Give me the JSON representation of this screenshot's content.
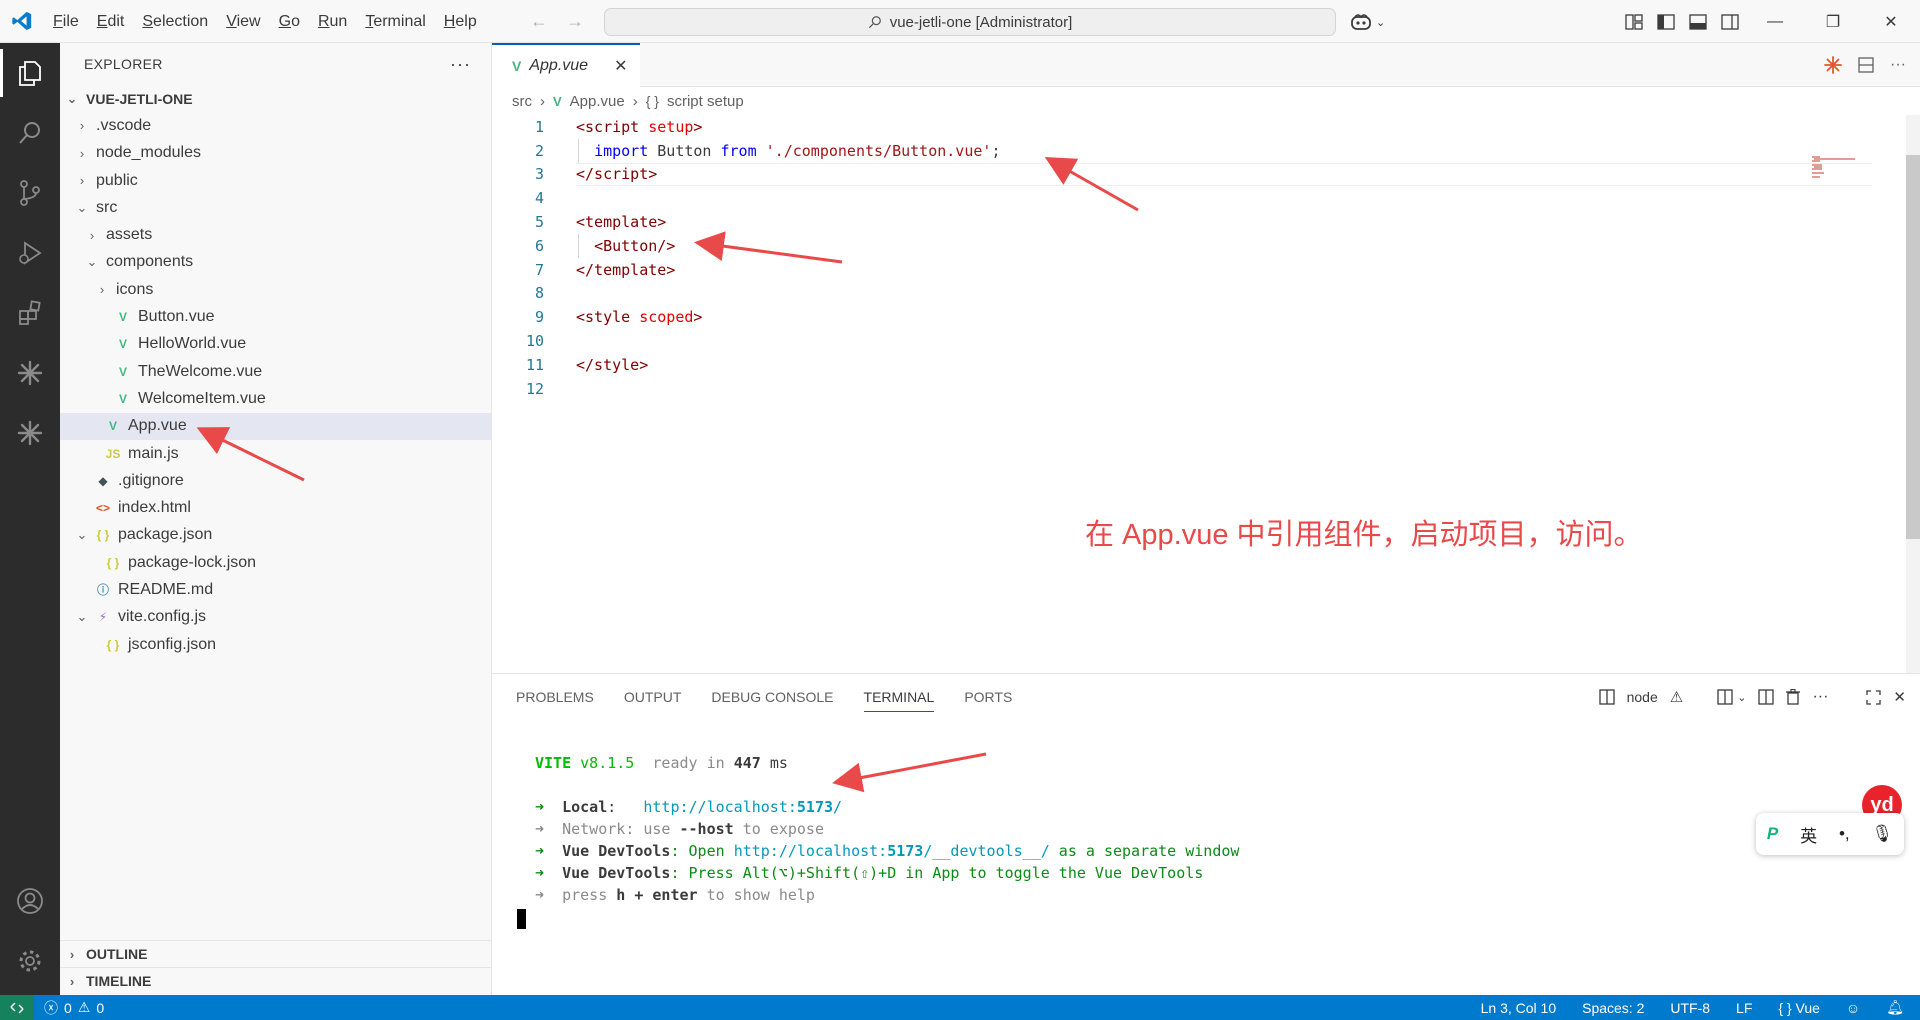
{
  "titlebar": {
    "menus": [
      {
        "label": "File",
        "u": "F",
        "rest": "ile"
      },
      {
        "label": "Edit",
        "u": "E",
        "rest": "dit"
      },
      {
        "label": "Selection",
        "u": "S",
        "rest": "election"
      },
      {
        "label": "View",
        "u": "V",
        "rest": "iew"
      },
      {
        "label": "Go",
        "u": "G",
        "rest": "o"
      },
      {
        "label": "Run",
        "u": "R",
        "rest": "un"
      },
      {
        "label": "Terminal",
        "u": "T",
        "rest": "erminal"
      },
      {
        "label": "Help",
        "u": "H",
        "rest": "elp"
      }
    ],
    "search_text": "vue-jetli-one [Administrator]"
  },
  "sidebar": {
    "title": "EXPLORER",
    "project": "VUE-JETLI-ONE",
    "tree": [
      {
        "name": ".vscode",
        "kind": "folder",
        "open": false,
        "depth": 1
      },
      {
        "name": "node_modules",
        "kind": "folder",
        "open": false,
        "depth": 1
      },
      {
        "name": "public",
        "kind": "folder",
        "open": false,
        "depth": 1
      },
      {
        "name": "src",
        "kind": "folder",
        "open": true,
        "depth": 1
      },
      {
        "name": "assets",
        "kind": "folder",
        "open": false,
        "depth": 2
      },
      {
        "name": "components",
        "kind": "folder",
        "open": true,
        "depth": 2
      },
      {
        "name": "icons",
        "kind": "folder",
        "open": false,
        "depth": 3
      },
      {
        "name": "Button.vue",
        "kind": "vue",
        "depth": 3
      },
      {
        "name": "HelloWorld.vue",
        "kind": "vue",
        "depth": 3
      },
      {
        "name": "TheWelcome.vue",
        "kind": "vue",
        "depth": 3
      },
      {
        "name": "WelcomeItem.vue",
        "kind": "vue",
        "depth": 3
      },
      {
        "name": "App.vue",
        "kind": "vue",
        "depth": 2,
        "selected": true
      },
      {
        "name": "main.js",
        "kind": "js",
        "depth": 2
      },
      {
        "name": ".gitignore",
        "kind": "git",
        "depth": 1
      },
      {
        "name": "index.html",
        "kind": "html",
        "depth": 1
      },
      {
        "name": "package.json",
        "kind": "json",
        "open": true,
        "depth": 1
      },
      {
        "name": "package-lock.json",
        "kind": "json",
        "depth": 2
      },
      {
        "name": "README.md",
        "kind": "info",
        "depth": 1
      },
      {
        "name": "vite.config.js",
        "kind": "vite",
        "open": true,
        "depth": 1
      },
      {
        "name": "jsconfig.json",
        "kind": "json",
        "depth": 2
      }
    ],
    "outline": "OUTLINE",
    "timeline": "TIMELINE"
  },
  "editor": {
    "tab_label": "App.vue",
    "breadcrumb": {
      "folder": "src",
      "file": "App.vue",
      "symbol": "script setup"
    },
    "line_numbers": [
      "1",
      "2",
      "3",
      "4",
      "5",
      "6",
      "7",
      "8",
      "9",
      "10",
      "11",
      "12"
    ],
    "annotation": "在 App.vue 中引用组件，启动项目，访问。"
  },
  "panel": {
    "tabs": [
      "PROBLEMS",
      "OUTPUT",
      "DEBUG CONSOLE",
      "TERMINAL",
      "PORTS"
    ],
    "active_tab": "TERMINAL",
    "terminal_name": "node",
    "terminal": {
      "vite": "VITE",
      "version": "v8.1.5",
      "ready": "ready in",
      "ms_value": "447",
      "ms_unit": "ms",
      "local_label": "Local",
      "local_url_a": "http://localhost:",
      "local_port": "5173",
      "local_url_b": "/",
      "network_label": "Network",
      "network_text_a": ": use ",
      "network_flag": "--host",
      "network_text_b": " to expose",
      "devtools_label": "Vue DevTools",
      "devtools_open": ": Open ",
      "devtools_url_a": "http://localhost:",
      "devtools_port": "5173",
      "devtools_url_b": "/__devtools__/",
      "devtools_window": " as a separate window",
      "devtools_press": ": Press Alt(⌥)+Shift(⇧)+D in App to toggle the Vue DevTools",
      "help_a": "press ",
      "help_key": "h + enter",
      "help_b": " to show help"
    }
  },
  "ime": {
    "logo": "yd",
    "lang": "英",
    "punct": "•,"
  },
  "statusbar": {
    "errors": "0",
    "warnings": "0",
    "position": "Ln 3, Col 10",
    "spaces": "Spaces: 2",
    "encoding": "UTF-8",
    "eol": "LF",
    "language": "Vue"
  },
  "colors": {
    "accent": "#007acc",
    "annotation": "#e84a4a",
    "vue": "#41b883"
  }
}
